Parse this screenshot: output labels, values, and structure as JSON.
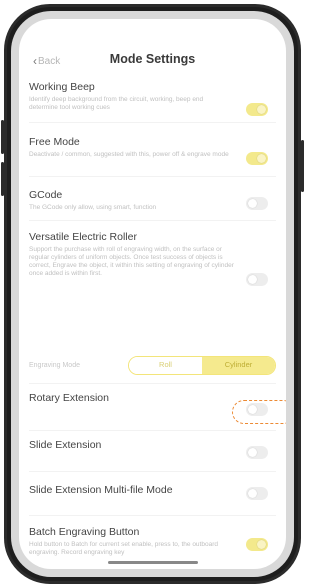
{
  "header": {
    "back_label": "Back",
    "title": "Mode Settings"
  },
  "settings": [
    {
      "title": "Working Beep",
      "description": "Identify deep background from the circuit, working, beep end determine tool working cues",
      "toggle": "on"
    },
    {
      "title": "Free Mode",
      "description": "Deactivate / common, suggested with this, power off & engrave mode",
      "toggle": "on"
    },
    {
      "title": "GCode",
      "description": "The GCode only allow, using smart, function",
      "toggle": "off"
    },
    {
      "title": "Versatile Electric Roller",
      "description": "Support the purchase with roll of engraving width, on the surface or regular cylinders of uniform objects. Once test success of objects is correct, Engrave the object, it within this setting of engraving of cylinder once added is within first.",
      "toggle": "off"
    },
    {
      "title": "Rotary Extension",
      "description": "",
      "toggle": "off"
    },
    {
      "title": "Slide Extension",
      "description": "",
      "toggle": "off"
    },
    {
      "title": "Slide Extension Multi-file Mode",
      "description": "",
      "toggle": "off"
    },
    {
      "title": "Batch Engraving Button",
      "description": "Hold button to Batch for current set enable, press to, the outboard engraving. Record engraving key",
      "toggle": "on"
    }
  ],
  "engraving_mode": {
    "label": "Engraving Mode",
    "options": [
      "Roll",
      "Cylinder"
    ],
    "selected": "Cylinder"
  },
  "colors": {
    "accent": "#f3e57a",
    "toggle_on": "#f3e98c",
    "toggle_off": "#ededed",
    "highlight_dashed": "#ec8a34"
  }
}
